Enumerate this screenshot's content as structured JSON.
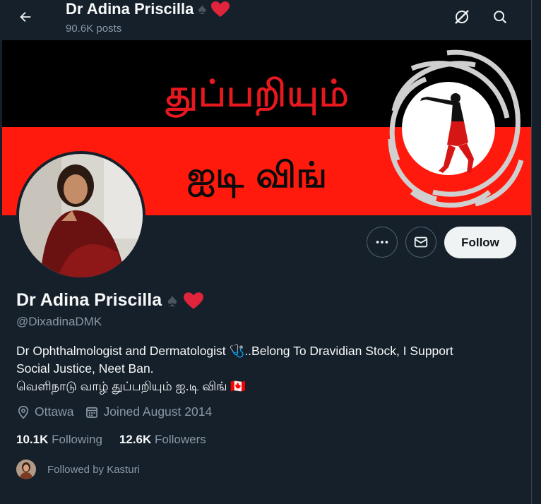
{
  "header": {
    "title": "Dr Adina Priscilla",
    "posts": "90.6K posts"
  },
  "banner": {
    "line1": "துப்பறியும்",
    "line2": "ஐடி விங்"
  },
  "profile": {
    "name": "Dr Adina Priscilla",
    "handle": "@DixadinaDMK",
    "bio_line1": "Dr Ophthalmologist and Dermatologist 🩺..Belong To Dravidian Stock, I Support",
    "bio_line2": "Social Justice, Neet Ban.",
    "bio_line3": "வெளிநாடு வாழ் துப்பறியும் ஐ.டி விங் 🇨🇦",
    "location": "Ottawa",
    "joined": "Joined August 2014",
    "following_count": "10.1K",
    "following_label": "Following",
    "followers_count": "12.6K",
    "followers_label": "Followers",
    "followed_by": "Followed by Kasturi"
  },
  "actions": {
    "follow_label": "Follow"
  },
  "icons": {
    "back": "arrow-left-icon",
    "grok": "grok-icon",
    "search": "search-icon",
    "more": "more-icon",
    "message": "mail-icon",
    "location": "location-pin-icon",
    "calendar": "calendar-icon"
  },
  "colors": {
    "background": "#15202b",
    "follow_button": "#eff3f4",
    "heart": "#f91880",
    "banner_red": "#ff1a0d"
  }
}
